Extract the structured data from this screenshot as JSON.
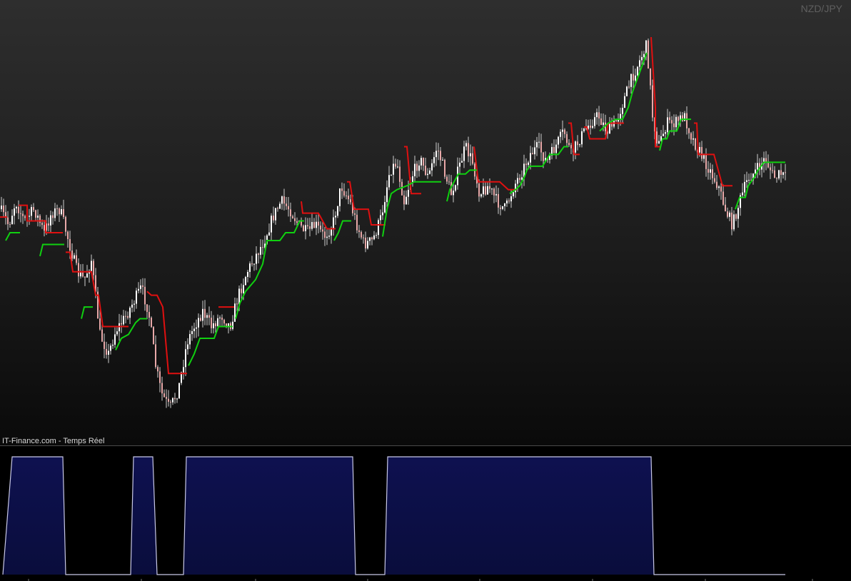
{
  "header": {
    "symbol": "NZD/JPY",
    "source": "IT-Finance.com - Temps Réel"
  },
  "colors": {
    "candle_up": "#ffffff",
    "candle_down": "#e8a8a8",
    "wick": "#cfcfcf",
    "trailing_stop_bear": "#e01010",
    "trailing_stop_bull": "#10d010",
    "oscillator_fill": "#0a0d3c",
    "oscillator_line": "#c8c8e6"
  },
  "chart_data": [
    {
      "type": "candlestick",
      "title": "",
      "xlabel": "",
      "ylabel": "",
      "ylim": [
        0,
        100
      ],
      "grid": false,
      "close_path": [
        [
          0,
          44
        ],
        [
          12,
          48
        ],
        [
          22,
          42
        ],
        [
          34,
          47
        ],
        [
          48,
          44
        ],
        [
          62,
          50
        ],
        [
          72,
          45
        ],
        [
          84,
          44
        ],
        [
          96,
          52
        ],
        [
          108,
          60
        ],
        [
          118,
          62
        ],
        [
          128,
          57
        ],
        [
          140,
          76
        ],
        [
          152,
          81
        ],
        [
          162,
          75
        ],
        [
          174,
          72
        ],
        [
          186,
          68
        ],
        [
          198,
          64
        ],
        [
          208,
          70
        ],
        [
          218,
          84
        ],
        [
          226,
          91
        ],
        [
          238,
          95
        ],
        [
          250,
          90
        ],
        [
          262,
          78
        ],
        [
          272,
          74
        ],
        [
          284,
          70
        ],
        [
          296,
          74
        ],
        [
          310,
          71
        ],
        [
          322,
          74
        ],
        [
          334,
          66
        ],
        [
          346,
          60
        ],
        [
          358,
          56
        ],
        [
          370,
          52
        ],
        [
          382,
          46
        ],
        [
          394,
          42
        ],
        [
          406,
          44
        ],
        [
          418,
          48
        ],
        [
          430,
          50
        ],
        [
          442,
          48
        ],
        [
          454,
          51
        ],
        [
          466,
          48
        ],
        [
          478,
          38
        ],
        [
          490,
          42
        ],
        [
          500,
          48
        ],
        [
          510,
          53
        ],
        [
          522,
          52
        ],
        [
          534,
          46
        ],
        [
          546,
          34
        ],
        [
          556,
          32
        ],
        [
          566,
          42
        ],
        [
          576,
          36
        ],
        [
          588,
          31
        ],
        [
          600,
          36
        ],
        [
          612,
          28
        ],
        [
          622,
          34
        ],
        [
          632,
          40
        ],
        [
          642,
          34
        ],
        [
          652,
          28
        ],
        [
          662,
          32
        ],
        [
          672,
          40
        ],
        [
          684,
          38
        ],
        [
          696,
          42
        ],
        [
          708,
          44
        ],
        [
          720,
          38
        ],
        [
          732,
          34
        ],
        [
          742,
          30
        ],
        [
          754,
          28
        ],
        [
          766,
          32
        ],
        [
          778,
          28
        ],
        [
          790,
          24
        ],
        [
          800,
          30
        ],
        [
          812,
          26
        ],
        [
          826,
          22
        ],
        [
          838,
          20
        ],
        [
          850,
          24
        ],
        [
          862,
          22
        ],
        [
          874,
          16
        ],
        [
          886,
          10
        ],
        [
          896,
          6
        ],
        [
          906,
          2
        ],
        [
          914,
          20
        ],
        [
          922,
          28
        ],
        [
          934,
          22
        ],
        [
          946,
          22
        ],
        [
          958,
          20
        ],
        [
          970,
          26
        ],
        [
          982,
          30
        ],
        [
          994,
          34
        ],
        [
          1006,
          38
        ],
        [
          1016,
          44
        ],
        [
          1026,
          48
        ],
        [
          1036,
          42
        ],
        [
          1048,
          36
        ],
        [
          1060,
          34
        ],
        [
          1072,
          31
        ],
        [
          1084,
          36
        ],
        [
          1094,
          35
        ],
        [
          1100,
          36
        ]
      ],
      "series": [
        {
          "style": "trailing-stop-bearish",
          "segments": [
            [
              [
                0,
                46
              ],
              [
                10,
                46
              ]
            ],
            [
              [
                26,
                43
              ],
              [
                38,
                43
              ],
              [
                38,
                47
              ],
              [
                64,
                47
              ],
              [
                64,
                50
              ],
              [
                88,
                50
              ]
            ],
            [
              [
                92,
                55
              ],
              [
                98,
                55
              ],
              [
                102,
                60
              ],
              [
                128,
                60
              ],
              [
                134,
                66
              ],
              [
                138,
                66
              ],
              [
                144,
                74
              ],
              [
                180,
                74
              ]
            ],
            [
              [
                206,
                65
              ],
              [
                212,
                66
              ],
              [
                220,
                66
              ],
              [
                228,
                69
              ],
              [
                236,
                86
              ],
              [
                262,
                86
              ]
            ],
            [
              [
                306,
                69
              ],
              [
                328,
                69
              ]
            ],
            [
              [
                422,
                42
              ],
              [
                424,
                45
              ],
              [
                446,
                45
              ],
              [
                458,
                49
              ],
              [
                470,
                49
              ]
            ],
            [
              [
                486,
                37
              ],
              [
                490,
                37
              ],
              [
                496,
                44
              ],
              [
                516,
                44
              ],
              [
                520,
                48
              ],
              [
                540,
                48
              ]
            ],
            [
              [
                566,
                28
              ],
              [
                570,
                28
              ],
              [
                576,
                40
              ],
              [
                590,
                40
              ]
            ],
            [
              [
                664,
                28
              ],
              [
                670,
                37
              ],
              [
                700,
                37
              ],
              [
                712,
                39
              ],
              [
                724,
                39
              ]
            ],
            [
              [
                796,
                22
              ],
              [
                800,
                22
              ],
              [
                804,
                30
              ],
              [
                812,
                30
              ]
            ],
            [
              [
                818,
                23
              ],
              [
                822,
                23
              ],
              [
                826,
                26
              ],
              [
                848,
                26
              ],
              [
                852,
                22
              ],
              [
                874,
                22
              ]
            ],
            [
              [
                912,
                0
              ],
              [
                918,
                18
              ],
              [
                918,
                28
              ],
              [
                926,
                28
              ]
            ],
            [
              [
                972,
                22
              ],
              [
                976,
                22
              ],
              [
                978,
                30
              ],
              [
                1000,
                30
              ],
              [
                1012,
                38
              ],
              [
                1026,
                38
              ]
            ]
          ]
        },
        {
          "style": "trailing-stop-bullish",
          "segments": [
            [
              [
                8,
                52
              ],
              [
                14,
                50
              ],
              [
                28,
                50
              ]
            ],
            [
              [
                56,
                56
              ],
              [
                60,
                53
              ],
              [
                90,
                53
              ]
            ],
            [
              [
                114,
                72
              ],
              [
                118,
                69
              ],
              [
                130,
                69
              ]
            ],
            [
              [
                162,
                80
              ],
              [
                170,
                77
              ],
              [
                180,
                76
              ],
              [
                190,
                73
              ],
              [
                196,
                72
              ],
              [
                206,
                72
              ]
            ],
            [
              [
                264,
                84
              ],
              [
                272,
                81
              ],
              [
                280,
                77
              ],
              [
                300,
                77
              ],
              [
                306,
                74
              ],
              [
                326,
                74
              ]
            ],
            [
              [
                330,
                72
              ],
              [
                336,
                68
              ],
              [
                344,
                65
              ],
              [
                358,
                62
              ],
              [
                368,
                58
              ],
              [
                374,
                52
              ],
              [
                392,
                52
              ],
              [
                400,
                50
              ],
              [
                412,
                50
              ],
              [
                420,
                47
              ],
              [
                426,
                47
              ]
            ],
            [
              [
                468,
                52
              ],
              [
                474,
                50
              ],
              [
                480,
                47
              ],
              [
                492,
                47
              ]
            ],
            [
              [
                536,
                51
              ],
              [
                542,
                44
              ],
              [
                548,
                40
              ],
              [
                556,
                39
              ],
              [
                570,
                38
              ],
              [
                580,
                37
              ],
              [
                618,
                37
              ]
            ],
            [
              [
                626,
                42
              ],
              [
                630,
                39
              ],
              [
                642,
                35
              ],
              [
                652,
                35
              ],
              [
                658,
                34
              ],
              [
                668,
                34
              ]
            ],
            [
              [
                714,
                40
              ],
              [
                722,
                39
              ],
              [
                728,
                38
              ],
              [
                734,
                36
              ],
              [
                738,
                34
              ],
              [
                742,
                33
              ],
              [
                760,
                33
              ],
              [
                770,
                30
              ],
              [
                782,
                30
              ],
              [
                790,
                28
              ],
              [
                796,
                28
              ]
            ],
            [
              [
                840,
                24
              ],
              [
                846,
                23
              ],
              [
                852,
                22
              ],
              [
                862,
                21
              ],
              [
                872,
                21
              ],
              [
                880,
                18
              ],
              [
                886,
                14
              ],
              [
                894,
                10
              ],
              [
                900,
                7
              ],
              [
                906,
                4
              ]
            ],
            [
              [
                924,
                29
              ],
              [
                928,
                26
              ],
              [
                934,
                26
              ],
              [
                938,
                24
              ],
              [
                948,
                24
              ],
              [
                954,
                21
              ],
              [
                968,
                21
              ]
            ],
            [
              [
                1030,
                44
              ],
              [
                1036,
                41
              ],
              [
                1044,
                41
              ],
              [
                1048,
                38
              ],
              [
                1056,
                36
              ],
              [
                1062,
                34
              ],
              [
                1070,
                32
              ],
              [
                1100,
                32
              ]
            ]
          ]
        }
      ]
    },
    {
      "type": "area",
      "title": "",
      "xlabel": "",
      "ylabel": "",
      "ylim": [
        0,
        1
      ],
      "grid": false,
      "x": [
        4,
        17,
        88,
        92,
        183,
        187,
        214,
        220,
        257,
        261,
        494,
        498,
        539,
        543,
        912,
        916,
        1100
      ],
      "values": [
        0,
        1,
        1,
        0,
        0,
        1,
        1,
        0,
        0,
        1,
        1,
        0,
        0,
        1,
        1,
        0,
        0
      ]
    }
  ]
}
